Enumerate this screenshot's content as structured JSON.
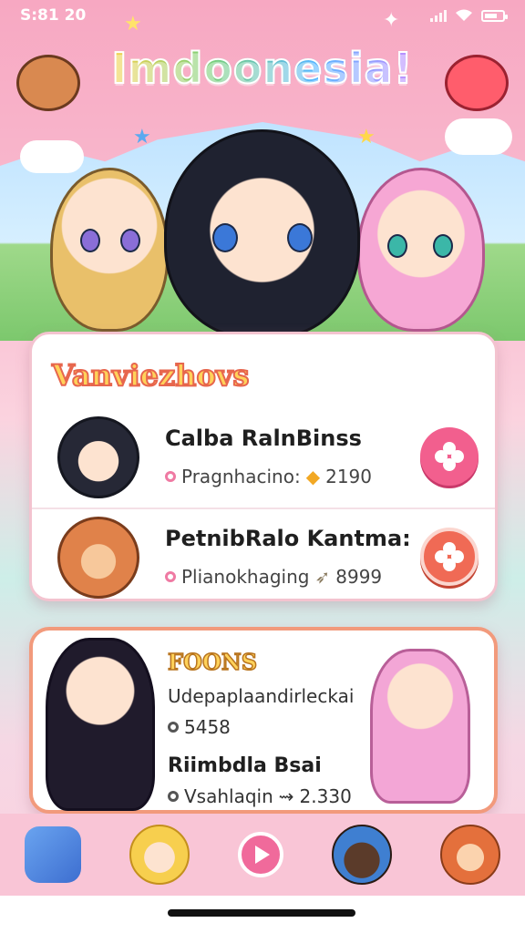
{
  "status_bar": {
    "time": "S:81 20",
    "icons": [
      "signal-icon",
      "wifi-icon",
      "battery-icon"
    ]
  },
  "header": {
    "app_title": "Imdoonesia!",
    "mascots": [
      "bear-mascot-icon",
      "red-blob-mascot-icon"
    ],
    "characters": [
      "blonde-boy-character",
      "dark-hair-boy-character",
      "pink-hair-girl-character"
    ]
  },
  "top_card": {
    "section_title": "Vanviezhovs",
    "items": [
      {
        "name": "Calba RalnBinss",
        "meta_label": "Pragnhacino:",
        "meta_value": "2190",
        "avatar": "dark-hair-boy-avatar",
        "action_icon": "flower-icon"
      },
      {
        "name": "PetnibRalo Kantma:",
        "meta_label": "Plianokhaging",
        "meta_value": "8999",
        "avatar": "bear-avatar",
        "action_icon": "flower-icon"
      }
    ]
  },
  "featured_card": {
    "title": "FOONS",
    "subtitle": "Udepaplaandirleckai",
    "count": "5458",
    "name": "Riimbdla Bsai",
    "meta_label": "Vsahlaqin",
    "meta_value": "2.330"
  },
  "bottom_nav": {
    "items": [
      {
        "icon": "blue-block-icon"
      },
      {
        "icon": "blonde-girl-icon"
      },
      {
        "icon": "play-icon",
        "label": ""
      },
      {
        "icon": "mole-hat-icon"
      },
      {
        "icon": "fox-icon"
      }
    ]
  },
  "colors": {
    "accent_pink": "#f25f8e",
    "accent_orange": "#f06a55",
    "title_yellow": "#ffd25a"
  }
}
